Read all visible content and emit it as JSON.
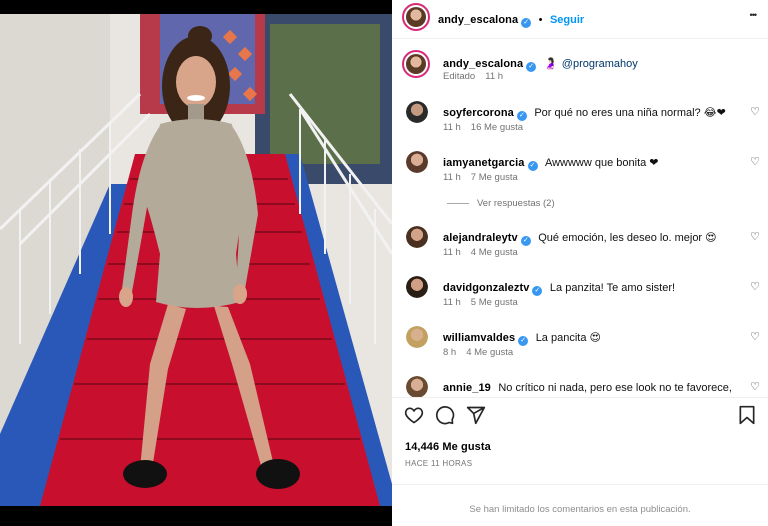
{
  "header": {
    "username": "andy_escalona",
    "dot": "•",
    "follow_label": "Seguir",
    "more_label": "•••"
  },
  "caption": {
    "username": "andy_escalona",
    "text": "@programahoy",
    "edited_label": "Editado",
    "time": "11 h"
  },
  "comments": [
    {
      "username": "soyfercorona",
      "text": "Por qué no eres una niña normal? 😂❤",
      "time": "11 h",
      "likes": "16 Me gusta",
      "verified": true
    },
    {
      "username": "iamyanetgarcia",
      "text": "Awwwww que bonita ❤",
      "time": "11 h",
      "likes": "7 Me gusta",
      "verified": true
    },
    {
      "username": "alejandraleytv",
      "text": "Qué emoción, les deseo lo. mejor 😍",
      "time": "11 h",
      "likes": "4 Me gusta",
      "verified": true
    },
    {
      "username": "davidgonzaleztv",
      "text": "La panzita! Te amo sister!",
      "time": "11 h",
      "likes": "5 Me gusta",
      "verified": true
    },
    {
      "username": "williamvaldes",
      "text": "La pancita 😍",
      "time": "8 h",
      "likes": "4 Me gusta",
      "verified": true
    },
    {
      "username": "annie_19",
      "text": "No crítico ni nada, pero ese look no te favorece,",
      "verified": false
    }
  ],
  "view_replies": "Ver respuestas (2)",
  "likes_count": "14,446 Me gusta",
  "posted_ago": "HACE 11 HORAS",
  "comments_limited": "Se han limitado los comentarios en esta publicación.",
  "icons": {
    "like": "heart-outline-icon",
    "comment": "speech-bubble-icon",
    "share": "paper-plane-icon",
    "save": "bookmark-icon"
  },
  "colors": {
    "accent": "#0095f6",
    "verified": "#3897f0",
    "red_heart": "#ed4956",
    "meta": "#737373"
  }
}
